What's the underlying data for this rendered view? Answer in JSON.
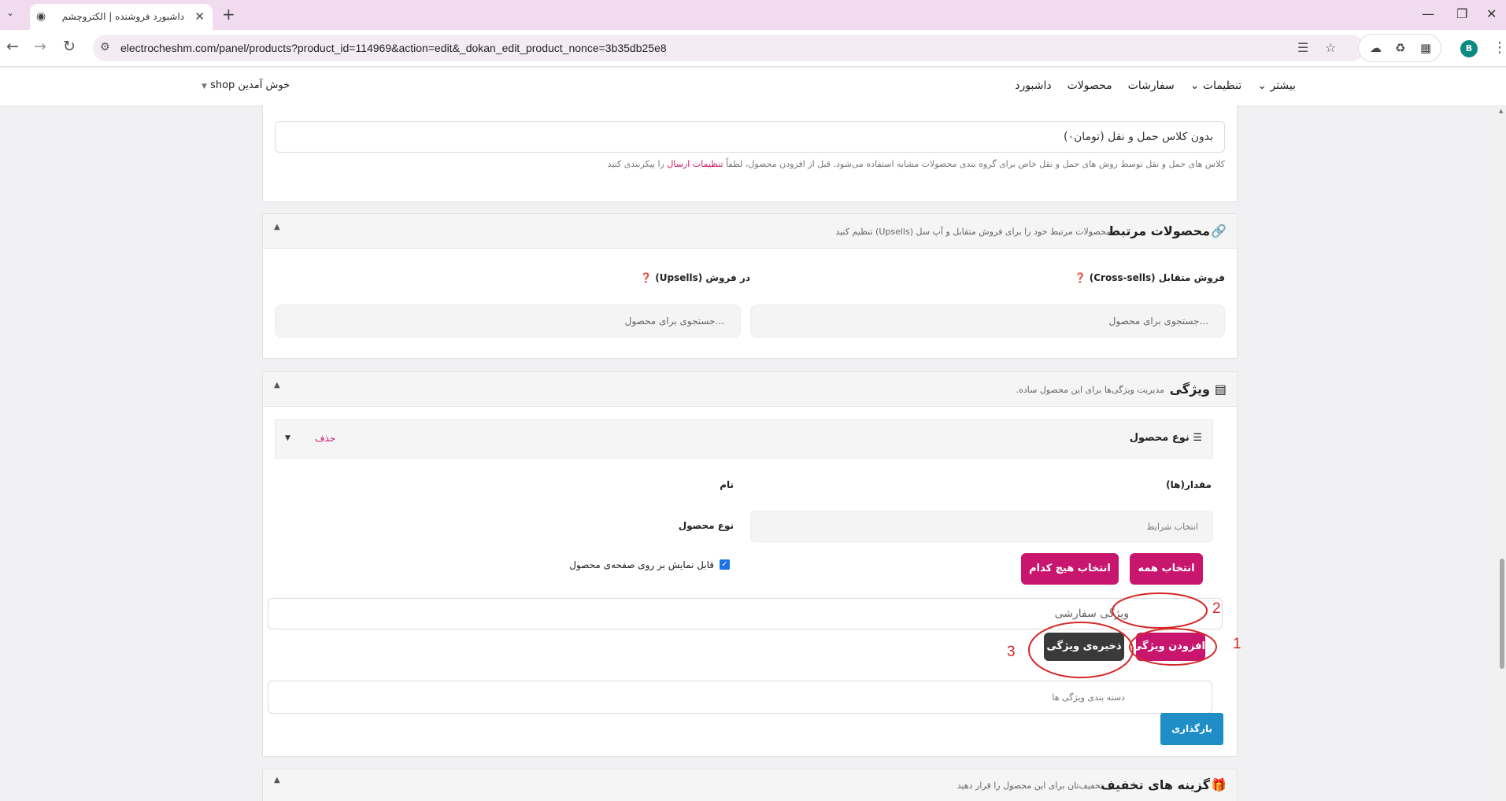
{
  "browser": {
    "tab_title": "داشبورد فروشنده | الکتروچشم",
    "url": "electrocheshm.com/panel/products?product_id=114969&action=edit&_dokan_edit_product_nonce=3b35db25e8",
    "avatar_letter": "B"
  },
  "site_header": {
    "menu": [
      "داشبورد",
      "محصولات",
      "سفارشات",
      "تنظیمات",
      "بیشتر"
    ],
    "welcome": "shop خوش آمدین"
  },
  "shipping": {
    "class_value": "بدون کلاس حمل و نقل (تومان۰)",
    "help_prefix": "کلاس های حمل و نقل توسط روش های حمل و نقل خاص برای گروه بندی محصولات مشابه استفاده می‌شود. قبل از افزودن محصول، لطفاً",
    "help_link": "تنظیمات ارسال",
    "help_suffix": "را پیکربندی کنید"
  },
  "linked_products": {
    "title": "محصولات مرتبط",
    "description": "محصولات مرتبط خود را برای فروش متقابل و آپ سل (Upsells) تنظیم کنید",
    "crosssells_label": "فروش متقابل (Cross-sells)",
    "upsells_label": "در فروش (Upsells)",
    "search_placeholder": "...جستجوی برای محصول"
  },
  "attributes": {
    "title": "ویژگی",
    "description": "مدیریت ویژگی‌ها برای این محصول ساده.",
    "attribute_name": "نوع محصول",
    "delete_label": "حذف",
    "values_label": "مقدار(ها)",
    "name_label": "نام",
    "name_value": "نوع محصول",
    "select_placeholder": "انتخاب شرایط",
    "select_all": "انتخاب همه",
    "select_none": "انتخاب هیچ کدام",
    "visible_label": "قابل نمایش بر روی صفحه‌ی محصول",
    "visible_checked": true,
    "custom_attribute_placeholder": "ویژگی سفارشی",
    "add_attribute": "افزودن ویژگی",
    "save_attribute": "ذخیره‌ی ویژگی",
    "category_placeholder": "دسته بندی ویژگی ها",
    "load_button": "بارگذاری"
  },
  "discount": {
    "title": "گزینه های تخفیف",
    "description": "تخفیف‌تان برای این محصول را قرار دهید"
  },
  "annotations": [
    "1",
    "2",
    "3"
  ],
  "colors": {
    "primary": "#c8166e",
    "dark_button": "#3a3a3a",
    "blue_button": "#1f8ec7",
    "annotation": "#d62828",
    "tab_bar": "#f1dcef"
  }
}
